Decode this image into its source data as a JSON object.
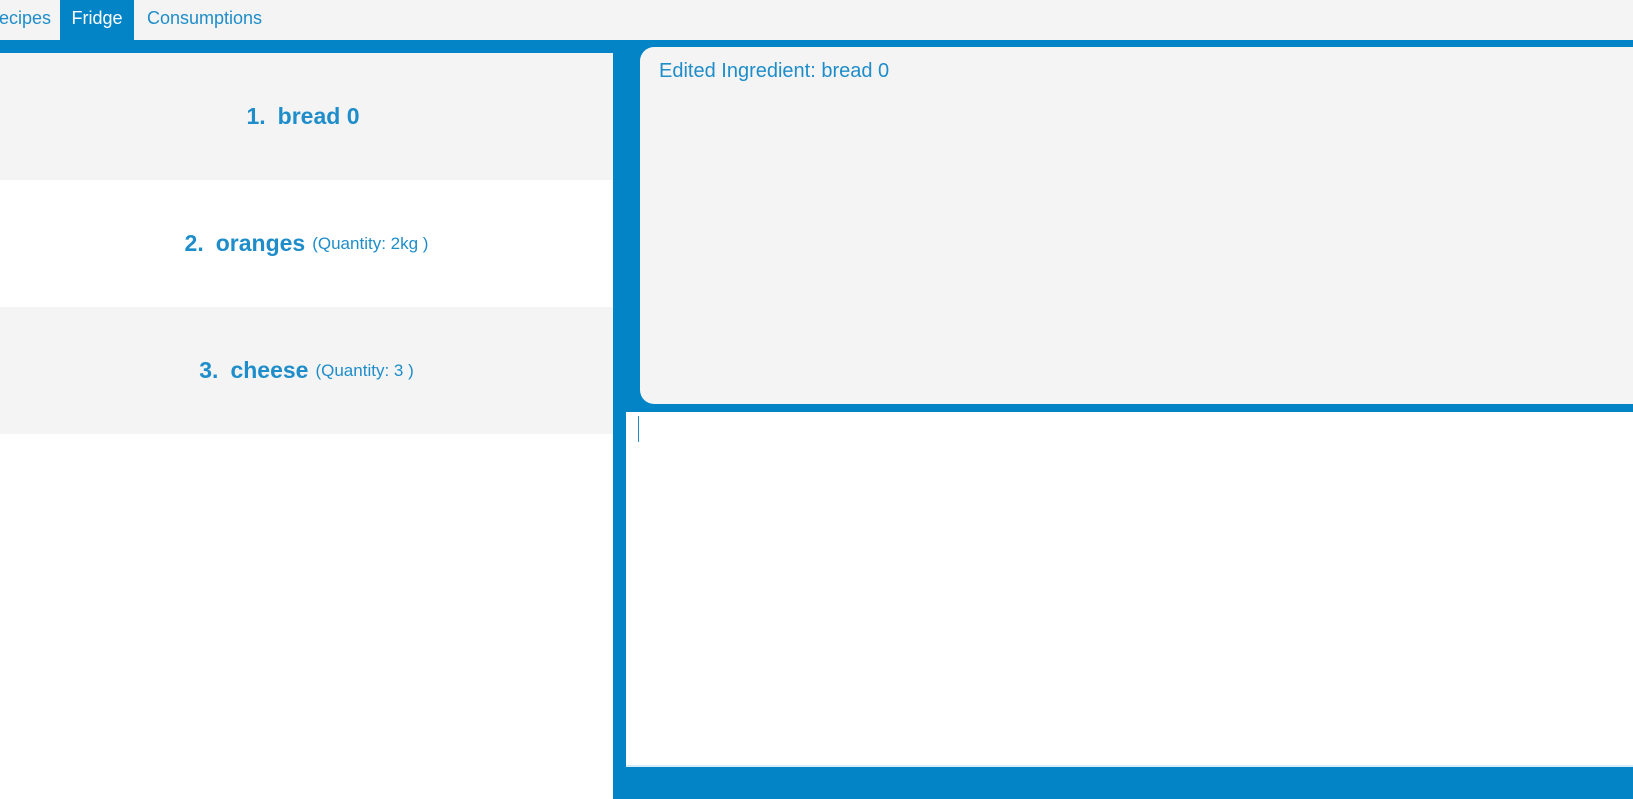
{
  "tabs": [
    {
      "label": "ecipes"
    },
    {
      "label": "Fridge"
    },
    {
      "label": "Consumptions"
    }
  ],
  "active_tab": "Fridge",
  "ingredients": [
    {
      "index": "1.",
      "name": "bread 0",
      "quantity": ""
    },
    {
      "index": "2.",
      "name": "oranges",
      "quantity": "(Quantity: 2kg )"
    },
    {
      "index": "3.",
      "name": "cheese",
      "quantity": "(Quantity: 3 )"
    }
  ],
  "result": {
    "message": "Edited Ingredient: bread 0"
  },
  "command": {
    "value": ""
  },
  "colors": {
    "accent": "#0284c7",
    "text": "#1e8dc9",
    "panel": "#f4f4f4"
  }
}
